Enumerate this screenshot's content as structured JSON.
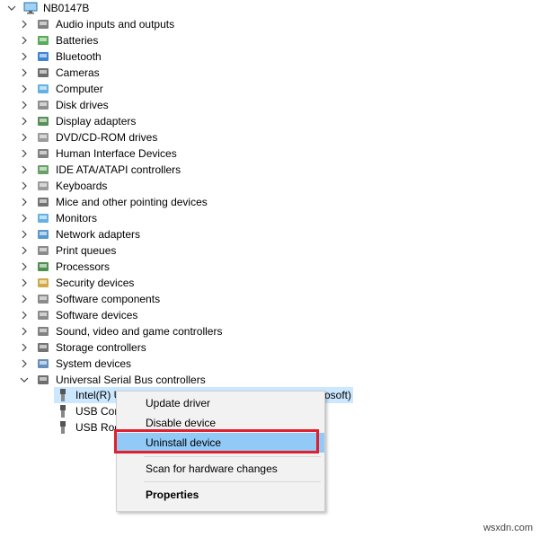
{
  "tree": {
    "root": "NB0147B",
    "categories": [
      "Audio inputs and outputs",
      "Batteries",
      "Bluetooth",
      "Cameras",
      "Computer",
      "Disk drives",
      "Display adapters",
      "DVD/CD-ROM drives",
      "Human Interface Devices",
      "IDE ATA/ATAPI controllers",
      "Keyboards",
      "Mice and other pointing devices",
      "Monitors",
      "Network adapters",
      "Print queues",
      "Processors",
      "Security devices",
      "Software components",
      "Software devices",
      "Sound, video and game controllers",
      "Storage controllers",
      "System devices",
      "Universal Serial Bus controllers"
    ],
    "usb_children": [
      {
        "label_visible": "Intel(R) U",
        "label_suffix": "osoft)"
      },
      {
        "label_visible": "USB Com"
      },
      {
        "label_visible": "USB Root"
      }
    ]
  },
  "context_menu": {
    "items": [
      "Update driver",
      "Disable device",
      "Uninstall device",
      "Scan for hardware changes",
      "Properties"
    ],
    "active_index": 2
  },
  "watermark": "wsxdn.com"
}
